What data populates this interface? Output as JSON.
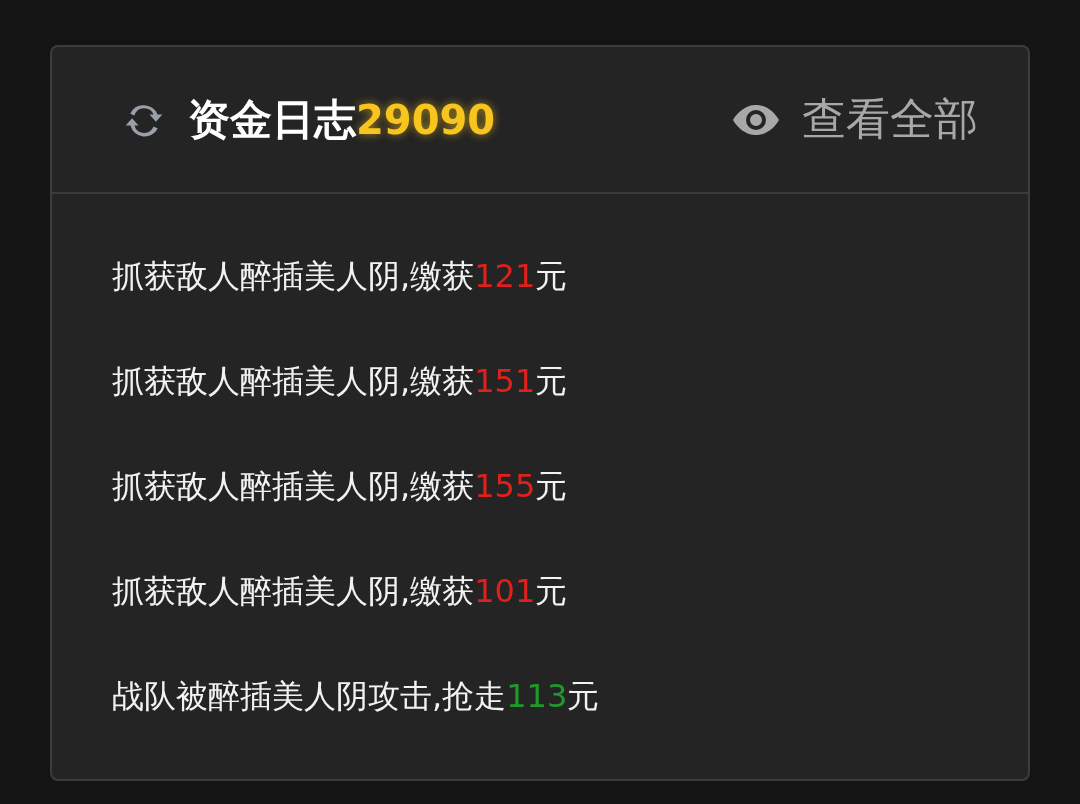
{
  "header": {
    "title": "资金日志",
    "total": "29090",
    "view_all": "查看全部"
  },
  "entries": [
    {
      "prefix": "抓获敌人醉插美人阴,缴获",
      "amount": "121",
      "suffix": "元",
      "kind": "income"
    },
    {
      "prefix": "抓获敌人醉插美人阴,缴获",
      "amount": "151",
      "suffix": "元",
      "kind": "income"
    },
    {
      "prefix": "抓获敌人醉插美人阴,缴获",
      "amount": "155",
      "suffix": "元",
      "kind": "income"
    },
    {
      "prefix": "抓获敌人醉插美人阴,缴获",
      "amount": "101",
      "suffix": "元",
      "kind": "income"
    },
    {
      "prefix": "战队被醉插美人阴攻击,抢走",
      "amount": "113",
      "suffix": "元",
      "kind": "loss"
    }
  ]
}
